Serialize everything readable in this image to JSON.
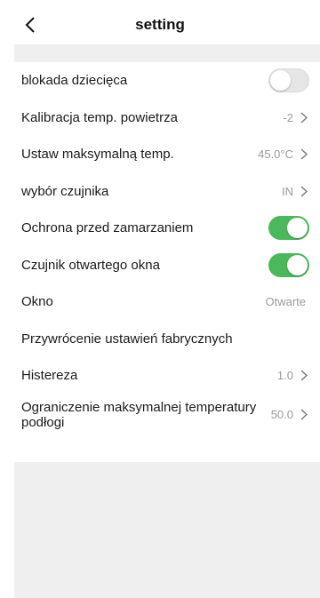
{
  "header": {
    "title": "setting",
    "back_icon": "chevron-left-icon"
  },
  "settings": [
    {
      "label": "blokada dziecięca",
      "type": "toggle",
      "on": false
    },
    {
      "label": "Kalibracja temp. powietrza",
      "type": "value",
      "value": "-2",
      "chevron": true
    },
    {
      "label": "Ustaw maksymalną temp.",
      "type": "value",
      "value": "45.0°C",
      "chevron": true
    },
    {
      "label": "wybór czujnika",
      "type": "value",
      "value": "IN",
      "chevron": true
    },
    {
      "label": "Ochrona przed zamarzaniem",
      "type": "toggle",
      "on": true
    },
    {
      "label": "Czujnik otwartego okna",
      "type": "toggle",
      "on": true
    },
    {
      "label": "Okno",
      "type": "value",
      "value": "Otwarte",
      "chevron": false
    },
    {
      "label": "Przywrócenie ustawień fabrycznych",
      "type": "action"
    },
    {
      "label": "Histereza",
      "type": "value",
      "value": "1.0",
      "chevron": true
    },
    {
      "label": "Ograniczenie maksymalnej temperatury podłogi",
      "type": "value",
      "value": "50.0",
      "chevron": true
    }
  ],
  "colors": {
    "toggle_on": "#4cb85c",
    "toggle_off": "#e6e6e6",
    "section_bg": "#efefef"
  }
}
